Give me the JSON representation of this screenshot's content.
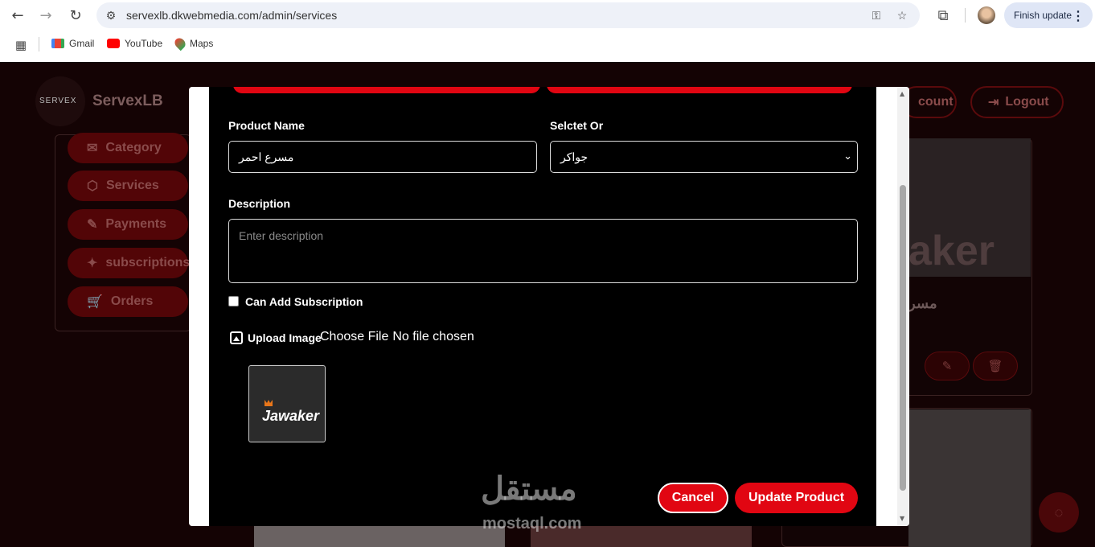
{
  "browser": {
    "url": "servexlb.dkwebmedia.com/admin/services",
    "finish_update_label": "Finish update",
    "bookmarks": [
      {
        "label": "Gmail"
      },
      {
        "label": "YouTube"
      },
      {
        "label": "Maps"
      }
    ]
  },
  "app": {
    "brand": "ServexLB",
    "logo_text": "SERVEX",
    "top_pills": [
      "count",
      "Logout"
    ],
    "sidebar": [
      {
        "label": "Category"
      },
      {
        "label": "Services"
      },
      {
        "label": "Payments"
      },
      {
        "label": "subscriptions"
      },
      {
        "label": "Orders"
      }
    ],
    "card_title_partial": "مسر",
    "card_image_text": "aker"
  },
  "modal": {
    "product_name_label": "Product Name",
    "product_name_value": "مسرع احمر",
    "select_label": "Selctet Or",
    "select_value": "جواكر",
    "description_label": "Description",
    "description_placeholder": "Enter description",
    "can_add_subscription_label": "Can Add Subscription",
    "upload_image_label": "Upload Image",
    "choose_file_label": "Choose File",
    "no_file_label": "No file chosen",
    "thumbnail_text": "Jawaker",
    "cancel_label": "Cancel",
    "update_label": "Update Product"
  },
  "watermark": {
    "arabic": "مستقل",
    "latin": "mostaql.com"
  },
  "colors": {
    "accent": "#e10612",
    "modal_bg": "#000000",
    "app_bg": "#140304"
  }
}
